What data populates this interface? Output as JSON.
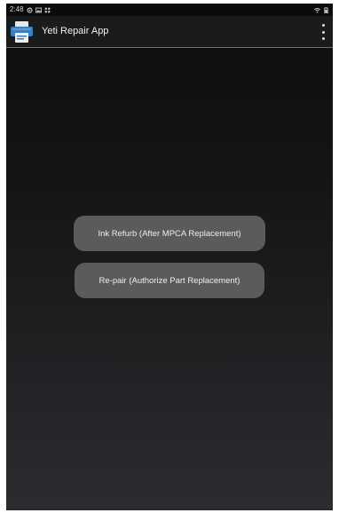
{
  "status_bar": {
    "time": "2:48",
    "left_icons": [
      "settings-icon",
      "image-icon",
      "grid-icon"
    ],
    "right_icons": [
      "wifi-icon",
      "battery-icon"
    ]
  },
  "app_bar": {
    "title": "Yeti Repair App",
    "app_icon": "printer-icon",
    "menu_icon": "overflow-menu-icon"
  },
  "main": {
    "buttons": [
      {
        "label": "Ink Refurb (After MPCA Replacement)"
      },
      {
        "label": "Re-pair (Authorize Part Replacement)"
      }
    ]
  },
  "colors": {
    "app_bar_divider": "#3e7fb0",
    "button_bg": "#5b5b5b",
    "icon_blue": "#3a7fc0"
  }
}
